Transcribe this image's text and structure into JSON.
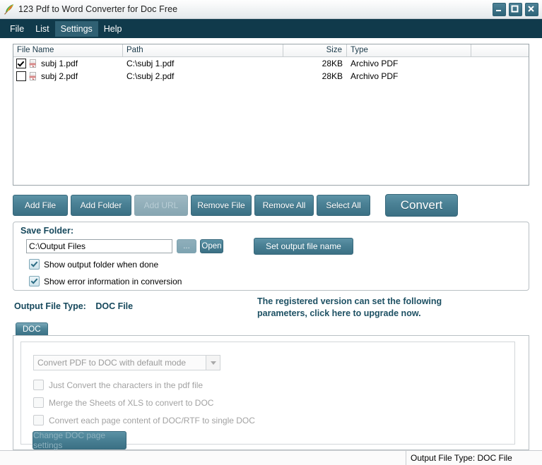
{
  "window": {
    "title": "123 Pdf to Word Converter for Doc Free",
    "icon": "feather-quill-icon",
    "controls": {
      "minimize": "minimize-icon",
      "maximize": "maximize-icon",
      "close": "close-icon"
    },
    "accent_color": "#3b7084",
    "menubar_color": "#103a4b"
  },
  "menu": {
    "items": [
      {
        "label": "File",
        "active": false
      },
      {
        "label": "List",
        "active": false
      },
      {
        "label": "Settings",
        "active": true
      },
      {
        "label": "Help",
        "active": false
      }
    ]
  },
  "file_list": {
    "columns": [
      "File Name",
      "Path",
      "Size",
      "Type",
      ""
    ],
    "rows": [
      {
        "checked": true,
        "name": "subj 1.pdf",
        "path": "C:\\subj 1.pdf",
        "size": "28KB",
        "type": "Archivo PDF"
      },
      {
        "checked": false,
        "name": "subj 2.pdf",
        "path": "C:\\subj 2.pdf",
        "size": "28KB",
        "type": "Archivo PDF"
      }
    ]
  },
  "toolbar": {
    "add_file": "Add File",
    "add_folder": "Add Folder",
    "add_url": "Add URL",
    "remove_file": "Remove File",
    "remove_all": "Remove All",
    "select_all": "Select All",
    "convert": "Convert"
  },
  "save_folder": {
    "title": "Save Folder:",
    "path_value": "C:\\Output Files",
    "browse_label": "...",
    "open_label": "Open",
    "set_output_label": "Set output file name",
    "checkbox_show_folder": {
      "label": "Show output folder when done",
      "checked": true
    },
    "checkbox_show_error": {
      "label": "Show error information in conversion",
      "checked": true
    }
  },
  "output": {
    "type_label": "Output File Type:",
    "type_value": "DOC File"
  },
  "upgrade_notice": "The registered version can set the following parameters, click here to upgrade now.",
  "tabs": [
    {
      "label": "DOC",
      "active": true
    }
  ],
  "options": {
    "mode_select_value": "Convert PDF to DOC with default mode",
    "checkbox_just_convert": {
      "label": "Just Convert the characters in the pdf file",
      "checked": false
    },
    "checkbox_merge_sheets": {
      "label": "Merge the Sheets of XLS to convert to DOC",
      "checked": false
    },
    "checkbox_single_doc": {
      "label": "Convert each page content of DOC/RTF to single DOC",
      "checked": false
    },
    "change_page_settings": "Change DOC page settings"
  },
  "status_bar": {
    "output_type": "Output File Type:  DOC File"
  }
}
